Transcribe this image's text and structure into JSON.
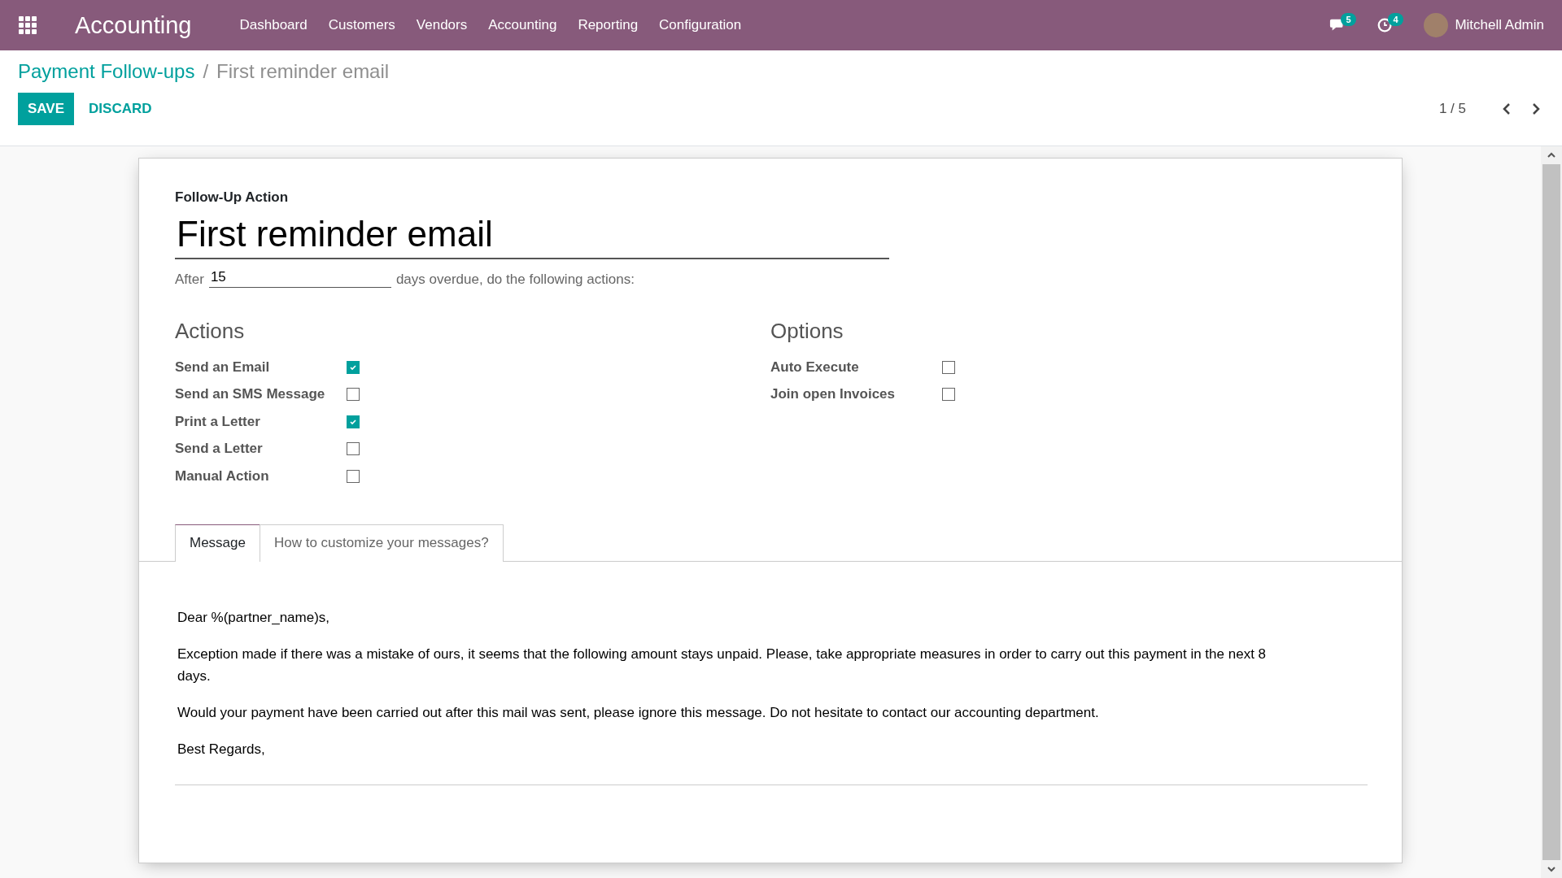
{
  "navbar": {
    "app_title": "Accounting",
    "menu": [
      "Dashboard",
      "Customers",
      "Vendors",
      "Accounting",
      "Reporting",
      "Configuration"
    ],
    "messages_badge": "5",
    "activities_badge": "4",
    "user": "Mitchell Admin"
  },
  "breadcrumb": {
    "parent": "Payment Follow-ups",
    "separator": "/",
    "current": "First reminder email"
  },
  "buttons": {
    "save": "SAVE",
    "discard": "DISCARD"
  },
  "pager": "1 / 5",
  "form": {
    "label": "Follow-Up Action",
    "name": "First reminder email",
    "after_label": "After",
    "delay": "15",
    "delay_suffix": "days overdue, do the following actions:",
    "groups": [
      {
        "title": "Actions",
        "fields": [
          {
            "label": "Send an Email",
            "checked": true
          },
          {
            "label": "Send an SMS Message",
            "checked": false
          },
          {
            "label": "Print a Letter",
            "checked": true
          },
          {
            "label": "Send a Letter",
            "checked": false
          },
          {
            "label": "Manual Action",
            "checked": false
          }
        ]
      },
      {
        "title": "Options",
        "fields": [
          {
            "label": "Auto Execute",
            "checked": false
          },
          {
            "label": "Join open Invoices",
            "checked": false
          }
        ]
      }
    ],
    "tabs": [
      {
        "label": "Message",
        "selected": true
      },
      {
        "label": "How to customize your messages?",
        "selected": false
      }
    ],
    "message": [
      "Dear %(partner_name)s,",
      "Exception made if there was a mistake of ours, it seems that the following amount stays unpaid. Please, take appropriate measures in order to carry out this payment in the next 8 days.",
      "Would your payment have been carried out after this mail was sent, please ignore this message. Do not hesitate to contact our accounting department.",
      "Best Regards,"
    ]
  }
}
